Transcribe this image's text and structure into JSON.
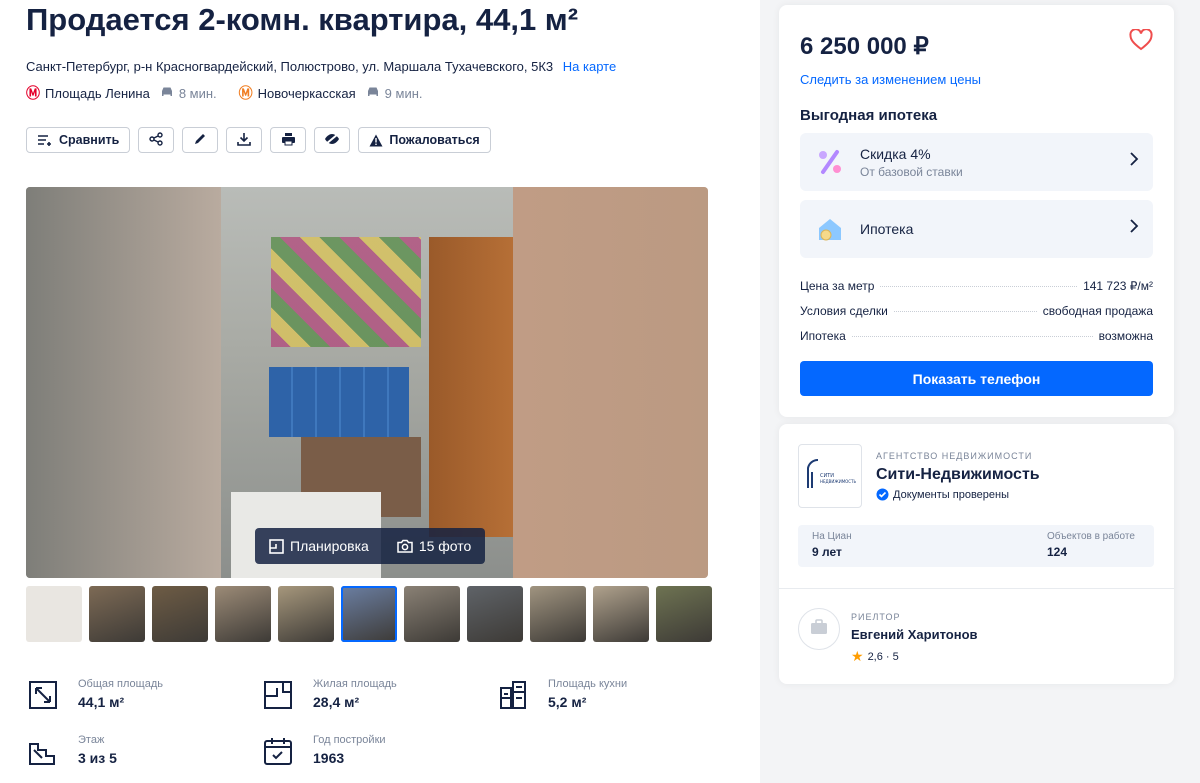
{
  "listing": {
    "title": "Продается 2-комн. квартира, 44,1 м²",
    "address": "Санкт-Петербург, р-н Красногвардейский, Полюстрово, ул. Маршала Тухачевского, 5К3",
    "map_link": "На карте",
    "metro": [
      {
        "name": "Площадь Ленина",
        "time": "8 мин.",
        "color": "#e4002b"
      },
      {
        "name": "Новочеркасская",
        "time": "9 мин.",
        "color": "#f07e23"
      }
    ]
  },
  "toolbar": {
    "compare": "Сравнить",
    "complain": "Пожаловаться"
  },
  "gallery": {
    "plan_button": "Планировка",
    "photos_button": "15 фото",
    "active_thumb_index": 5,
    "thumb_colors": [
      "#e9e6e1",
      "#7d6a55",
      "#6e5c45",
      "#9c8b77",
      "#a6977c",
      "#6b7fa3",
      "#8a8175",
      "#5f6368",
      "#a09480",
      "#b0a28d",
      "#6e7352"
    ]
  },
  "specs": [
    {
      "label": "Общая площадь",
      "value": "44,1 м²",
      "icon": "area-icon"
    },
    {
      "label": "Жилая площадь",
      "value": "28,4 м²",
      "icon": "living-area-icon"
    },
    {
      "label": "Площадь кухни",
      "value": "5,2 м²",
      "icon": "kitchen-icon"
    },
    {
      "label": "Этаж",
      "value": "3 из 5",
      "icon": "stairs-icon"
    },
    {
      "label": "Год постройки",
      "value": "1963",
      "icon": "calendar-icon"
    }
  ],
  "sidebar": {
    "price": "6 250 000 ₽",
    "follow_price": "Следить за изменением цены",
    "mortgage_title": "Выгодная ипотека",
    "offers": [
      {
        "title": "Скидка 4%",
        "subtitle": "От базовой ставки"
      },
      {
        "title": "Ипотека",
        "subtitle": ""
      }
    ],
    "details": [
      {
        "key": "Цена за метр",
        "value": "141 723 ₽/м²"
      },
      {
        "key": "Условия сделки",
        "value": "свободная продажа"
      },
      {
        "key": "Ипотека",
        "value": "возможна"
      }
    ],
    "phone_button": "Показать телефон"
  },
  "agency": {
    "type": "АГЕНТСТВО НЕДВИЖИМОСТИ",
    "name": "Сити-Недвижимость",
    "verified": "Документы проверены",
    "logo_text": "СИТИ-НЕДВИЖИМОСТЬ",
    "stats": [
      {
        "label": "На Циан",
        "value": "9 лет"
      },
      {
        "label": "Объектов в работе",
        "value": "124"
      }
    ]
  },
  "realtor": {
    "type": "РИЕЛТОР",
    "name": "Евгений Харитонов",
    "rating": "2,6 · 5"
  },
  "colors": {
    "accent": "#0468ff",
    "text": "#152242",
    "muted": "#7a8599",
    "heart": "#ef4d4d",
    "star": "#ff9d00"
  }
}
